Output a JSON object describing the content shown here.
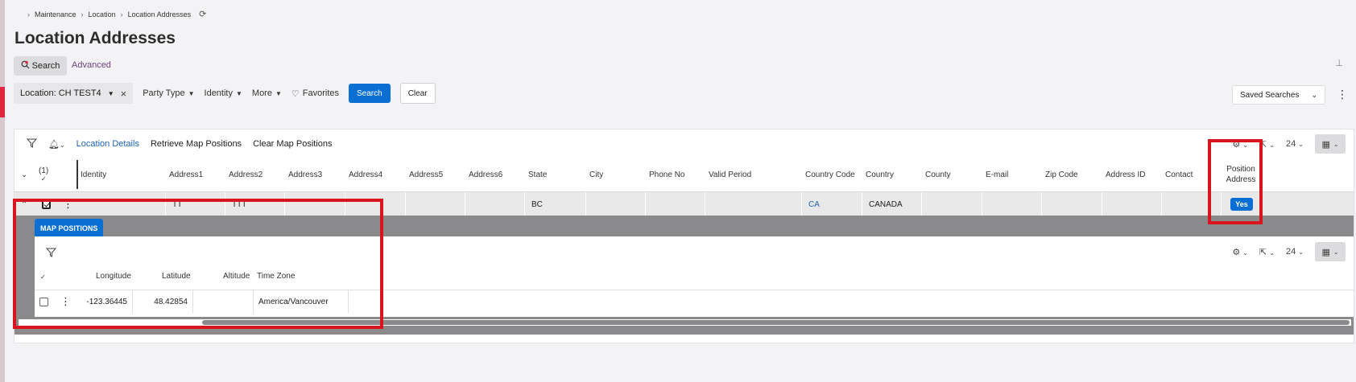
{
  "breadcrumb": [
    "Maintenance",
    "Location",
    "Location Addresses"
  ],
  "page": {
    "title": "Location Addresses"
  },
  "search": {
    "search_label": "Search",
    "advanced_label": "Advanced"
  },
  "filters": {
    "location_chip": "Location: CH TEST4",
    "party_type": "Party Type",
    "identity": "Identity",
    "more": "More",
    "favorites": "Favorites",
    "search_button": "Search",
    "clear_button": "Clear",
    "saved_searches": "Saved Searches"
  },
  "toolbar": {
    "location_details": "Location Details",
    "retrieve_map": "Retrieve Map Positions",
    "clear_map": "Clear Map Positions",
    "page_size": "24"
  },
  "table": {
    "selected_count": "(1)",
    "columns": [
      "Identity",
      "Address1",
      "Address2",
      "Address3",
      "Address4",
      "Address5",
      "Address6",
      "State",
      "City",
      "Phone No",
      "Valid Period",
      "Country Code",
      "Country",
      "County",
      "E-mail",
      "Zip Code",
      "Address ID",
      "Contact",
      "Position Address"
    ],
    "row": {
      "identity": "",
      "address1": "TT",
      "address2": "TTT",
      "address3": "",
      "address4": "",
      "address5": "",
      "address6": "",
      "state": "BC",
      "city": "",
      "phone": "",
      "valid_period": "",
      "country_code": "CA",
      "country": "CANADA",
      "county": "",
      "email": "",
      "zip": "",
      "address_id": "",
      "contact": "",
      "position_address": "Yes"
    }
  },
  "map_positions": {
    "tab_label": "MAP POSITIONS",
    "page_size": "24",
    "columns": [
      "Longitude",
      "Latitude",
      "Altitude",
      "Time Zone"
    ],
    "row": {
      "longitude": "-123.36445",
      "latitude": "48.42854",
      "altitude": "",
      "time_zone": "America/Vancouver"
    }
  },
  "colors": {
    "primary": "#0a6fd3",
    "highlight": "#d9141c",
    "link": "#1d63b4",
    "accent": "#e0263f"
  }
}
